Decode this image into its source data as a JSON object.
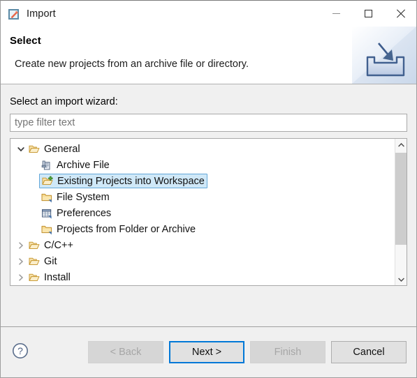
{
  "window": {
    "title": "Import",
    "icon": "import-wizard-icon",
    "controls": {
      "minimize": "minimize-icon",
      "maximize": "maximize-icon",
      "close": "close-icon"
    }
  },
  "banner": {
    "title": "Select",
    "description": "Create new projects from an archive file or directory.",
    "art": "import-tray-arrow-icon"
  },
  "form": {
    "label": "Select an import wizard:",
    "filter": {
      "value": "",
      "placeholder": "type filter text"
    }
  },
  "tree": {
    "items": [
      {
        "label": "General",
        "level": 0,
        "twisty": "chevron-down-icon",
        "icon": "folder-open-icon",
        "selected": false
      },
      {
        "label": "Archive File",
        "level": 1,
        "twisty": "none",
        "icon": "archive-file-icon",
        "selected": false
      },
      {
        "label": "Existing Projects into Workspace",
        "level": 1,
        "twisty": "none",
        "icon": "folder-import-icon",
        "selected": true
      },
      {
        "label": "File System",
        "level": 1,
        "twisty": "none",
        "icon": "folder-icon",
        "selected": false
      },
      {
        "label": "Preferences",
        "level": 1,
        "twisty": "none",
        "icon": "preferences-icon",
        "selected": false
      },
      {
        "label": "Projects from Folder or Archive",
        "level": 1,
        "twisty": "none",
        "icon": "folder-icon",
        "selected": false
      },
      {
        "label": "C/C++",
        "level": 0,
        "twisty": "chevron-right-icon",
        "icon": "folder-open-icon",
        "selected": false
      },
      {
        "label": "Git",
        "level": 0,
        "twisty": "chevron-right-icon",
        "icon": "folder-open-icon",
        "selected": false
      },
      {
        "label": "Install",
        "level": 0,
        "twisty": "chevron-right-icon",
        "icon": "folder-open-icon",
        "selected": false
      }
    ],
    "scrollbar": {
      "up": "scroll-up-arrow-icon",
      "down": "scroll-down-arrow-icon"
    }
  },
  "footer": {
    "help": "help-question-icon",
    "buttons": [
      {
        "label": "< Back",
        "state": "disabled",
        "name": "back-button"
      },
      {
        "label": "Next >",
        "state": "default",
        "name": "next-button"
      },
      {
        "label": "Finish",
        "state": "disabled",
        "name": "finish-button"
      },
      {
        "label": "Cancel",
        "state": "enabled",
        "name": "cancel-button"
      }
    ]
  },
  "colors": {
    "selection_bg": "#cfe8f8",
    "selection_border": "#63a8d8",
    "focus_border": "#0078d7",
    "dialog_bg": "#f0f0f0",
    "folder": "#f0c060"
  }
}
